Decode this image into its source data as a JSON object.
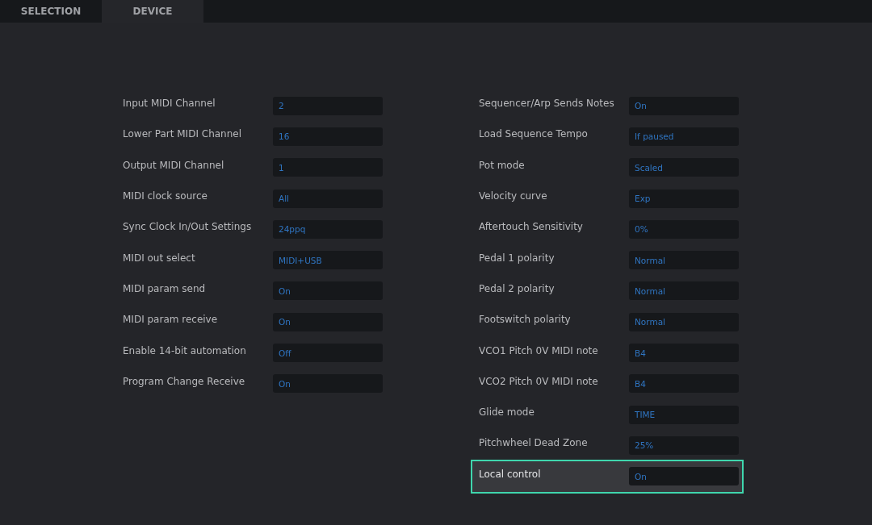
{
  "tabs": [
    {
      "label": "SELECTION",
      "selected": false
    },
    {
      "label": "DEVICE",
      "selected": true
    }
  ],
  "columns": [
    {
      "rows": [
        {
          "label": "Input MIDI Channel",
          "value": "2",
          "selected": false
        },
        {
          "label": "Lower Part MIDI Channel",
          "value": "16",
          "selected": false
        },
        {
          "label": "Output MIDI Channel",
          "value": "1",
          "selected": false
        },
        {
          "label": "MIDI clock source",
          "value": "All",
          "selected": false
        },
        {
          "label": "Sync Clock In/Out Settings",
          "value": "24ppq",
          "selected": false
        },
        {
          "label": "MIDI out select",
          "value": "MIDI+USB",
          "selected": false
        },
        {
          "label": "MIDI param send",
          "value": "On",
          "selected": false
        },
        {
          "label": "MIDI param receive",
          "value": "On",
          "selected": false
        },
        {
          "label": "Enable 14-bit automation",
          "value": "Off",
          "selected": false
        },
        {
          "label": "Program Change Receive",
          "value": "On",
          "selected": false
        }
      ]
    },
    {
      "rows": [
        {
          "label": "Sequencer/Arp Sends Notes",
          "value": "On",
          "selected": false
        },
        {
          "label": "Load Sequence Tempo",
          "value": "If paused",
          "selected": false
        },
        {
          "label": "Pot mode",
          "value": "Scaled",
          "selected": false
        },
        {
          "label": "Velocity curve",
          "value": "Exp",
          "selected": false
        },
        {
          "label": "Aftertouch Sensitivity",
          "value": "0%",
          "selected": false
        },
        {
          "label": "Pedal 1 polarity",
          "value": "Normal",
          "selected": false
        },
        {
          "label": "Pedal 2 polarity",
          "value": "Normal",
          "selected": false
        },
        {
          "label": "Footswitch polarity",
          "value": "Normal",
          "selected": false
        },
        {
          "label": "VCO1 Pitch 0V MIDI note",
          "value": "B4",
          "selected": false
        },
        {
          "label": "VCO2 Pitch 0V MIDI note",
          "value": "B4",
          "selected": false
        },
        {
          "label": "Glide mode",
          "value": "TIME",
          "selected": false
        },
        {
          "label": "Pitchwheel Dead Zone",
          "value": "25%",
          "selected": false
        },
        {
          "label": "Local control",
          "value": "On",
          "selected": true
        }
      ]
    }
  ]
}
